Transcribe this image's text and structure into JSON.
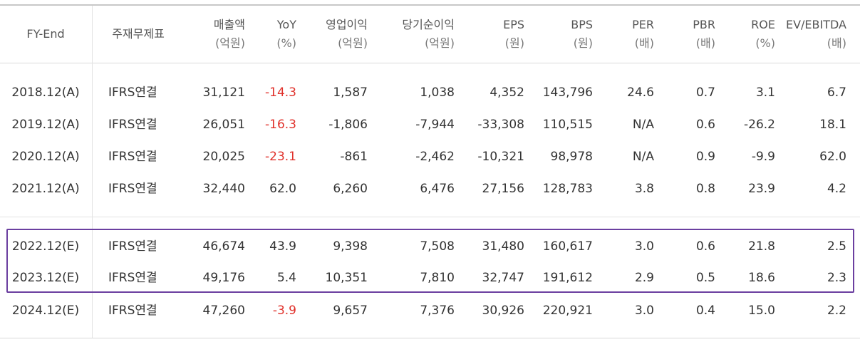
{
  "header": {
    "fy_end": "FY-End",
    "consolidation": "주재무제표",
    "columns": [
      {
        "key": "sales",
        "label": "매출액",
        "unit": "(억원)"
      },
      {
        "key": "yoy",
        "label": "YoY",
        "unit": "(%)"
      },
      {
        "key": "op_income",
        "label": "영업이익",
        "unit": "(억원)"
      },
      {
        "key": "net_income",
        "label": "당기순이익",
        "unit": "(억원)"
      },
      {
        "key": "eps",
        "label": "EPS",
        "unit": "(원)"
      },
      {
        "key": "bps",
        "label": "BPS",
        "unit": "(원)"
      },
      {
        "key": "per",
        "label": "PER",
        "unit": "(배)"
      },
      {
        "key": "pbr",
        "label": "PBR",
        "unit": "(배)"
      },
      {
        "key": "roe",
        "label": "ROE",
        "unit": "(%)"
      },
      {
        "key": "ev_ebitda",
        "label": "EV/EBITDA",
        "unit": "(배)"
      }
    ]
  },
  "rows": [
    {
      "fy": "2018.12(A)",
      "basis": "IFRS연결",
      "values": [
        "31,121",
        "-14.3",
        "1,587",
        "1,038",
        "4,352",
        "143,796",
        "24.6",
        "0.7",
        "3.1",
        "6.7"
      ],
      "yoy_negative": true
    },
    {
      "fy": "2019.12(A)",
      "basis": "IFRS연결",
      "values": [
        "26,051",
        "-16.3",
        "-1,806",
        "-7,944",
        "-33,308",
        "110,515",
        "N/A",
        "0.6",
        "-26.2",
        "18.1"
      ],
      "yoy_negative": true
    },
    {
      "fy": "2020.12(A)",
      "basis": "IFRS연결",
      "values": [
        "20,025",
        "-23.1",
        "-861",
        "-2,462",
        "-10,321",
        "98,978",
        "N/A",
        "0.9",
        "-9.9",
        "62.0"
      ],
      "yoy_negative": true
    },
    {
      "fy": "2021.12(A)",
      "basis": "IFRS연결",
      "values": [
        "32,440",
        "62.0",
        "6,260",
        "6,476",
        "27,156",
        "128,783",
        "3.8",
        "0.8",
        "23.9",
        "4.2"
      ],
      "yoy_negative": false
    },
    {
      "fy": "2022.12(E)",
      "basis": "IFRS연결",
      "values": [
        "46,674",
        "43.9",
        "9,398",
        "7,508",
        "31,480",
        "160,617",
        "3.0",
        "0.6",
        "21.8",
        "2.5"
      ],
      "yoy_negative": false
    },
    {
      "fy": "2023.12(E)",
      "basis": "IFRS연결",
      "values": [
        "49,176",
        "5.4",
        "10,351",
        "7,810",
        "32,747",
        "191,612",
        "2.9",
        "0.5",
        "18.6",
        "2.3"
      ],
      "yoy_negative": false
    },
    {
      "fy": "2024.12(E)",
      "basis": "IFRS연결",
      "values": [
        "47,260",
        "-3.9",
        "9,657",
        "7,376",
        "30,926",
        "220,921",
        "3.0",
        "0.4",
        "15.0",
        "2.2"
      ],
      "yoy_negative": true
    }
  ],
  "colors": {
    "negative_yoy": "#e0312b",
    "highlight_border": "#6b3fa0",
    "text": "#333333",
    "header_text": "#555555"
  }
}
